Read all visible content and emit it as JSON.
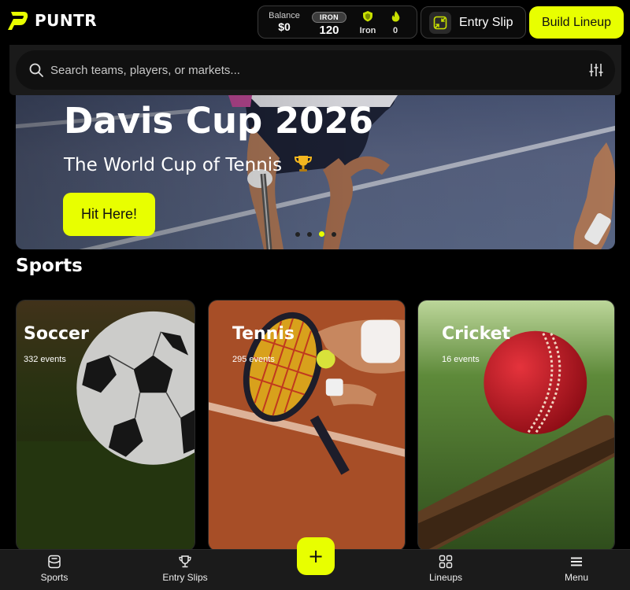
{
  "brand": {
    "name": "PUNTR",
    "accent": "#e8ff00",
    "logo_icon": "puntr-logo-icon"
  },
  "wallet": {
    "balance_label": "Balance",
    "balance_value": "$0",
    "tier_badge": "IRON",
    "tier_points": "120",
    "tier_icon": "shield-icon",
    "tier_name": "Iron",
    "streak_icon": "fire-icon",
    "streak_value": "0"
  },
  "header": {
    "entry_slip_label": "Entry Slip",
    "entry_slip_icon": "collapse-arrows-icon",
    "build_lineup_label": "Build Lineup"
  },
  "search": {
    "placeholder": "Search teams, players, or markets...",
    "value": "",
    "search_icon": "search-icon",
    "filter_icon": "sliders-icon"
  },
  "banner": {
    "title": "Davis Cup 2026",
    "subtitle": "The World Cup of Tennis",
    "subtitle_icon": "trophy-icon",
    "cta_label": "Hit Here!",
    "slide_count": 4,
    "active_slide": 3
  },
  "sports": {
    "title": "Sports",
    "items": [
      {
        "name": "Soccer",
        "events": "332 events",
        "icon": "soccer-ball-image"
      },
      {
        "name": "Tennis",
        "events": "295 events",
        "icon": "tennis-racket-image"
      },
      {
        "name": "Cricket",
        "events": "16 events",
        "icon": "cricket-ball-image"
      }
    ]
  },
  "bottom_nav": {
    "items": [
      {
        "label": "Sports",
        "icon": "sports-icon"
      },
      {
        "label": "Entry Slips",
        "icon": "trophy-icon"
      },
      {
        "label": "Lineups",
        "icon": "grid-icon"
      },
      {
        "label": "Menu",
        "icon": "menu-icon"
      }
    ],
    "fab_label": "+",
    "fab_icon": "plus-icon"
  }
}
